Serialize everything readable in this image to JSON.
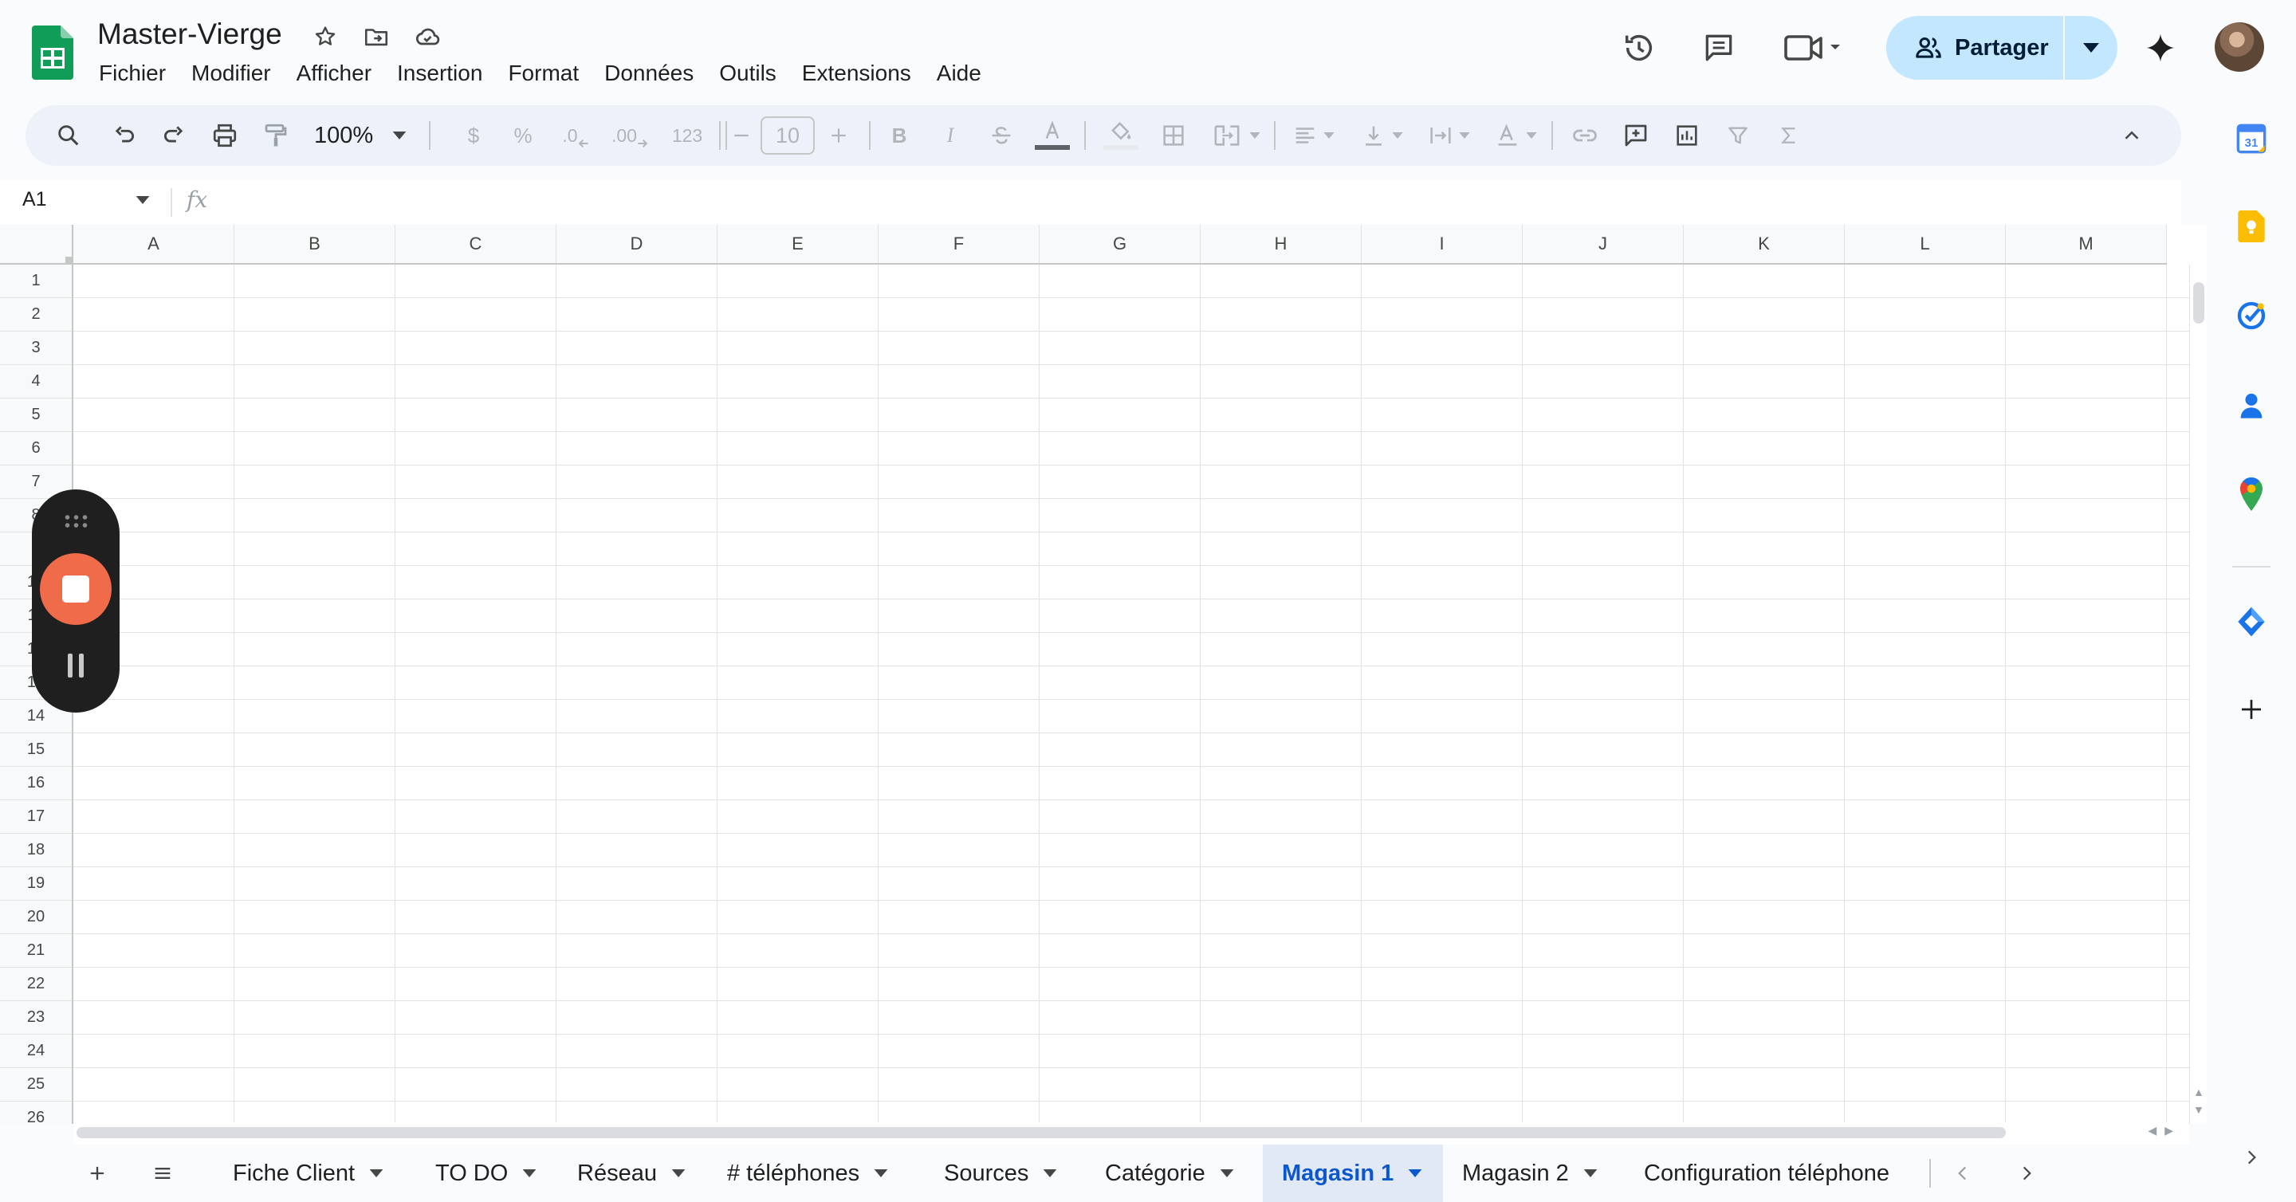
{
  "document": {
    "title": "Master-Vierge"
  },
  "menu": [
    "Fichier",
    "Modifier",
    "Afficher",
    "Insertion",
    "Format",
    "Données",
    "Outils",
    "Extensions",
    "Aide"
  ],
  "header": {
    "share_label": "Partager"
  },
  "toolbar": {
    "zoom": "100%",
    "currency_symbol": "$",
    "percent_symbol": "%",
    "decrease_decimal": ".0",
    "increase_decimal": ".00",
    "number_format": "123",
    "font_size": "10",
    "bold": "B",
    "italic": "I"
  },
  "formula_bar": {
    "cell_reference": "A1",
    "fx_label": "fx"
  },
  "grid": {
    "columns": [
      "A",
      "B",
      "C",
      "D",
      "E",
      "F",
      "G",
      "H",
      "I",
      "J",
      "K",
      "L",
      "M"
    ],
    "rows": [
      "1",
      "2",
      "3",
      "4",
      "5",
      "6",
      "7",
      "8",
      "9",
      "10",
      "11",
      "12",
      "13",
      "14",
      "15",
      "16",
      "17",
      "18",
      "19",
      "20",
      "21",
      "22",
      "23",
      "24",
      "25",
      "26"
    ]
  },
  "sheets": {
    "tabs": [
      {
        "label": "Fiche Client",
        "active": false
      },
      {
        "label": "TO DO",
        "active": false
      },
      {
        "label": "Réseau",
        "active": false
      },
      {
        "label": "# téléphones",
        "active": false
      },
      {
        "label": "Sources",
        "active": false
      },
      {
        "label": "Catégorie",
        "active": false
      },
      {
        "label": "Magasin 1",
        "active": true
      },
      {
        "label": "Magasin 2",
        "active": false
      },
      {
        "label": "Configuration téléphone",
        "active": false
      }
    ]
  },
  "side_panel": {
    "calendar_day": "31"
  },
  "colors": {
    "accent": "#0b57d0",
    "share_bg": "#c2e7ff",
    "sheets_green": "#0f9d58",
    "recorder_stop": "#ef6b4a"
  }
}
